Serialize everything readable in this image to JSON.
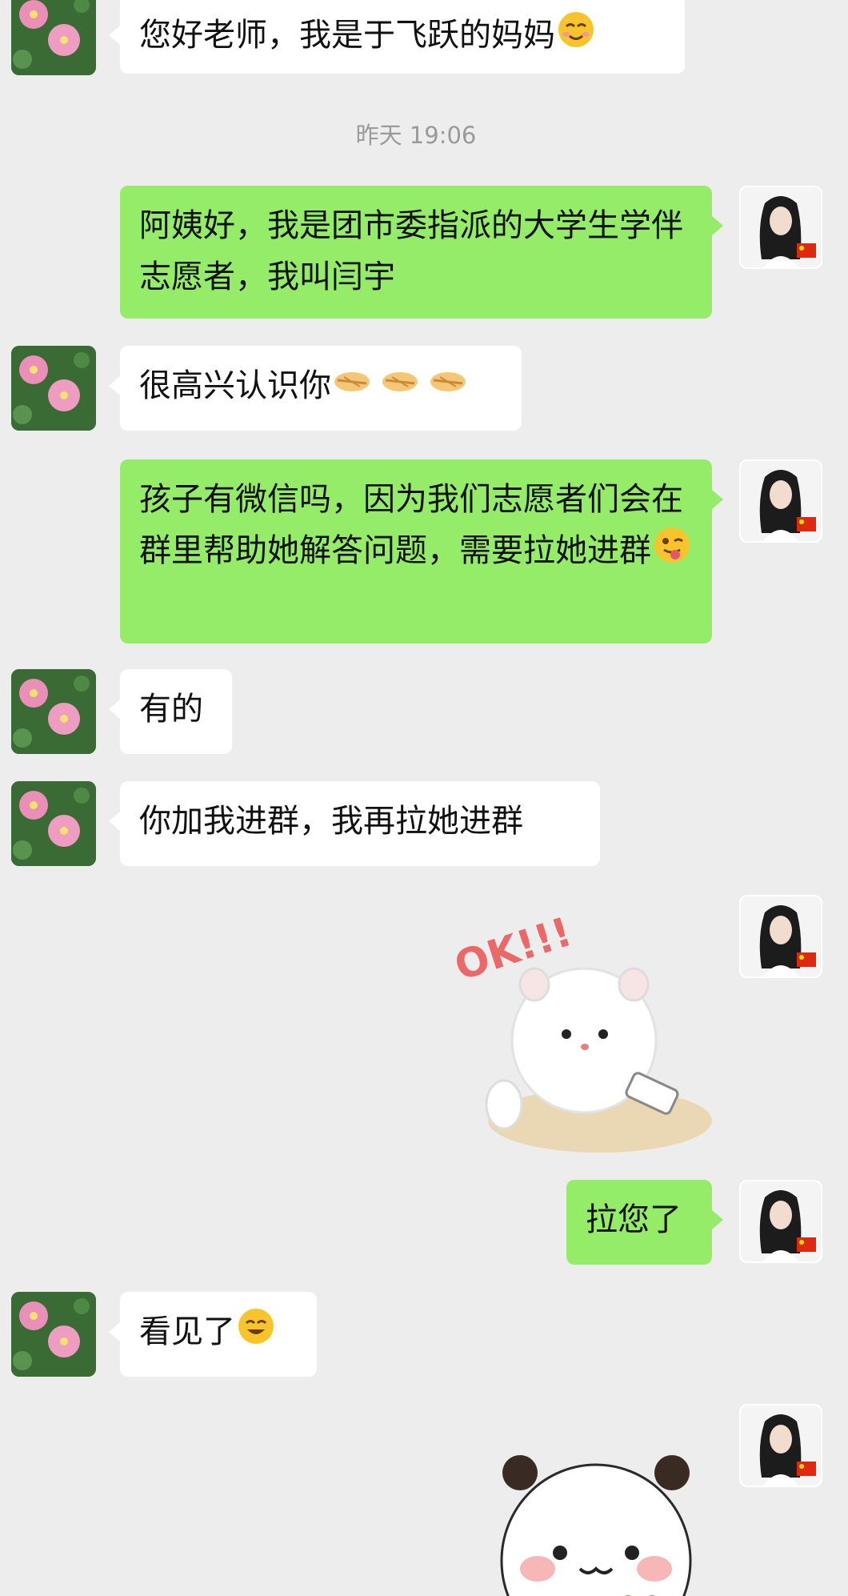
{
  "timestamp": "昨天 19:06",
  "messages": [
    {
      "text": "您好老师，我是于飞跃的妈妈",
      "emoji": "smiling-blush-emoji"
    },
    {
      "text": "阿姨好，我是团市委指派的大学生学伴志愿者，我叫闫宇"
    },
    {
      "text": "很高兴认识你",
      "emoji": "handshake-emoji x3"
    },
    {
      "text": "孩子有微信吗，因为我们志愿者们会在群里帮助她解答问题，需要拉她进群",
      "emoji": "winking-tongue-emoji"
    },
    {
      "text": "有的"
    },
    {
      "text": "你加我进群，我再拉她进群"
    },
    {
      "sticker": "ok-cat-sticker",
      "sticker_text": "OK!!!"
    },
    {
      "text": "拉您了"
    },
    {
      "text": "看见了",
      "emoji": "smiling-emoji"
    },
    {
      "sticker": "panda-sticker"
    }
  ],
  "colors": {
    "background": "#ededed",
    "incoming_bubble": "#ffffff",
    "outgoing_bubble": "#95ec69",
    "timestamp_text": "#9a9a9a"
  }
}
